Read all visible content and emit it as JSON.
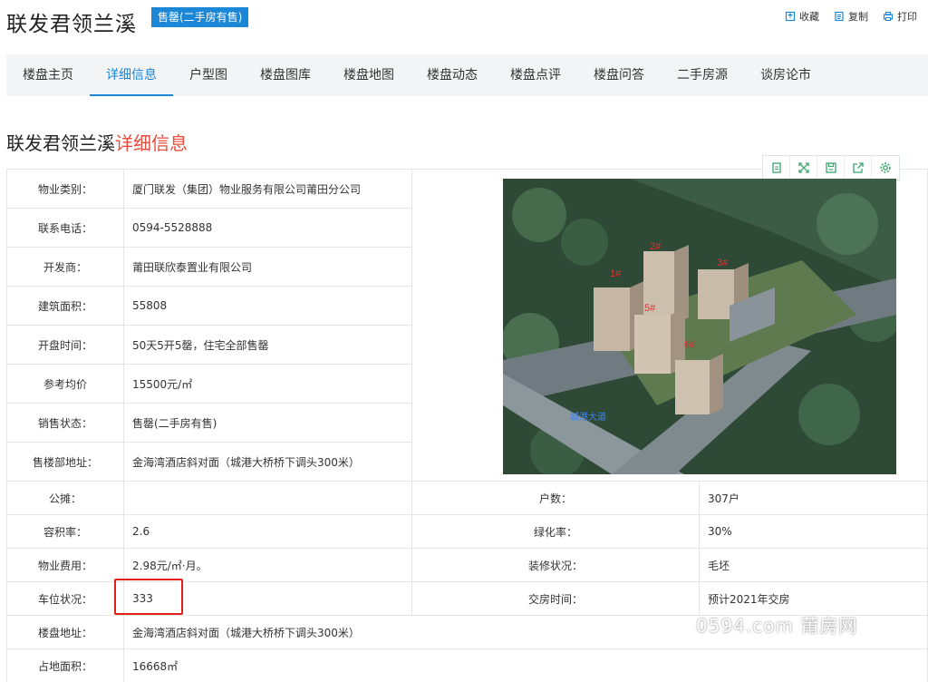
{
  "header": {
    "title": "联发君领兰溪",
    "badge": "售罄(二手房有售)",
    "actions": [
      {
        "label": "收藏",
        "icon": "bookmark-icon"
      },
      {
        "label": "复制",
        "icon": "copy-icon"
      },
      {
        "label": "打印",
        "icon": "print-icon"
      }
    ]
  },
  "nav": {
    "tabs": [
      "楼盘主页",
      "详细信息",
      "户型图",
      "楼盘图库",
      "楼盘地图",
      "楼盘动态",
      "楼盘点评",
      "楼盘问答",
      "二手房源",
      "谈房论市"
    ],
    "active": "详细信息"
  },
  "section": {
    "title": "联发君领兰溪",
    "accent": "详细信息"
  },
  "details": {
    "rows": [
      {
        "label": "物业类别：",
        "value": "厦门联发（集团）物业服务有限公司莆田分公司"
      },
      {
        "label": "联系电话：",
        "value": "0594-5528888"
      },
      {
        "label": "开发商：",
        "value": "莆田联欣泰置业有限公司"
      },
      {
        "label": "建筑面积：",
        "value": "55808"
      },
      {
        "label": "开盘时间：",
        "value": "50天5开5罄，住宅全部售罄"
      },
      {
        "label": "参考均价",
        "value": "15500元/㎡"
      },
      {
        "label": "销售状态：",
        "value": "售罄(二手房有售)"
      },
      {
        "label": "售楼部地址：",
        "value": "金海湾酒店斜对面（城港大桥桥下调头300米）"
      }
    ],
    "grid": [
      {
        "l1": "公摊：",
        "v1": "",
        "l2": "户数：",
        "v2": "307户"
      },
      {
        "l1": "容积率：",
        "v1": "2.6",
        "l2": "绿化率：",
        "v2": "30%"
      },
      {
        "l1": "物业费用：",
        "v1": "2.98元/㎡·月。",
        "l2": "装修状况：",
        "v2": "毛坯"
      },
      {
        "l1": "车位状况：",
        "v1": "333",
        "l2": "交房时间：",
        "v2": "预计2021年交房"
      }
    ],
    "bottom": [
      {
        "label": "楼盘地址：",
        "value": "金海湾酒店斜对面（城港大桥桥下调头300米）"
      },
      {
        "label": "占地面积：",
        "value": "16668㎡"
      }
    ]
  },
  "image": {
    "building_labels": [
      "1#",
      "2#",
      "3#",
      "5#",
      "6#"
    ],
    "road_label": "城港大道",
    "toolbar_icons": [
      "clipboard-icon",
      "expand-icon",
      "save-icon",
      "share-icon",
      "gear-icon"
    ]
  },
  "watermark": "0594.com 莆房网",
  "colors": {
    "accent": "#1b87d6",
    "highlight": "#e0201a"
  }
}
